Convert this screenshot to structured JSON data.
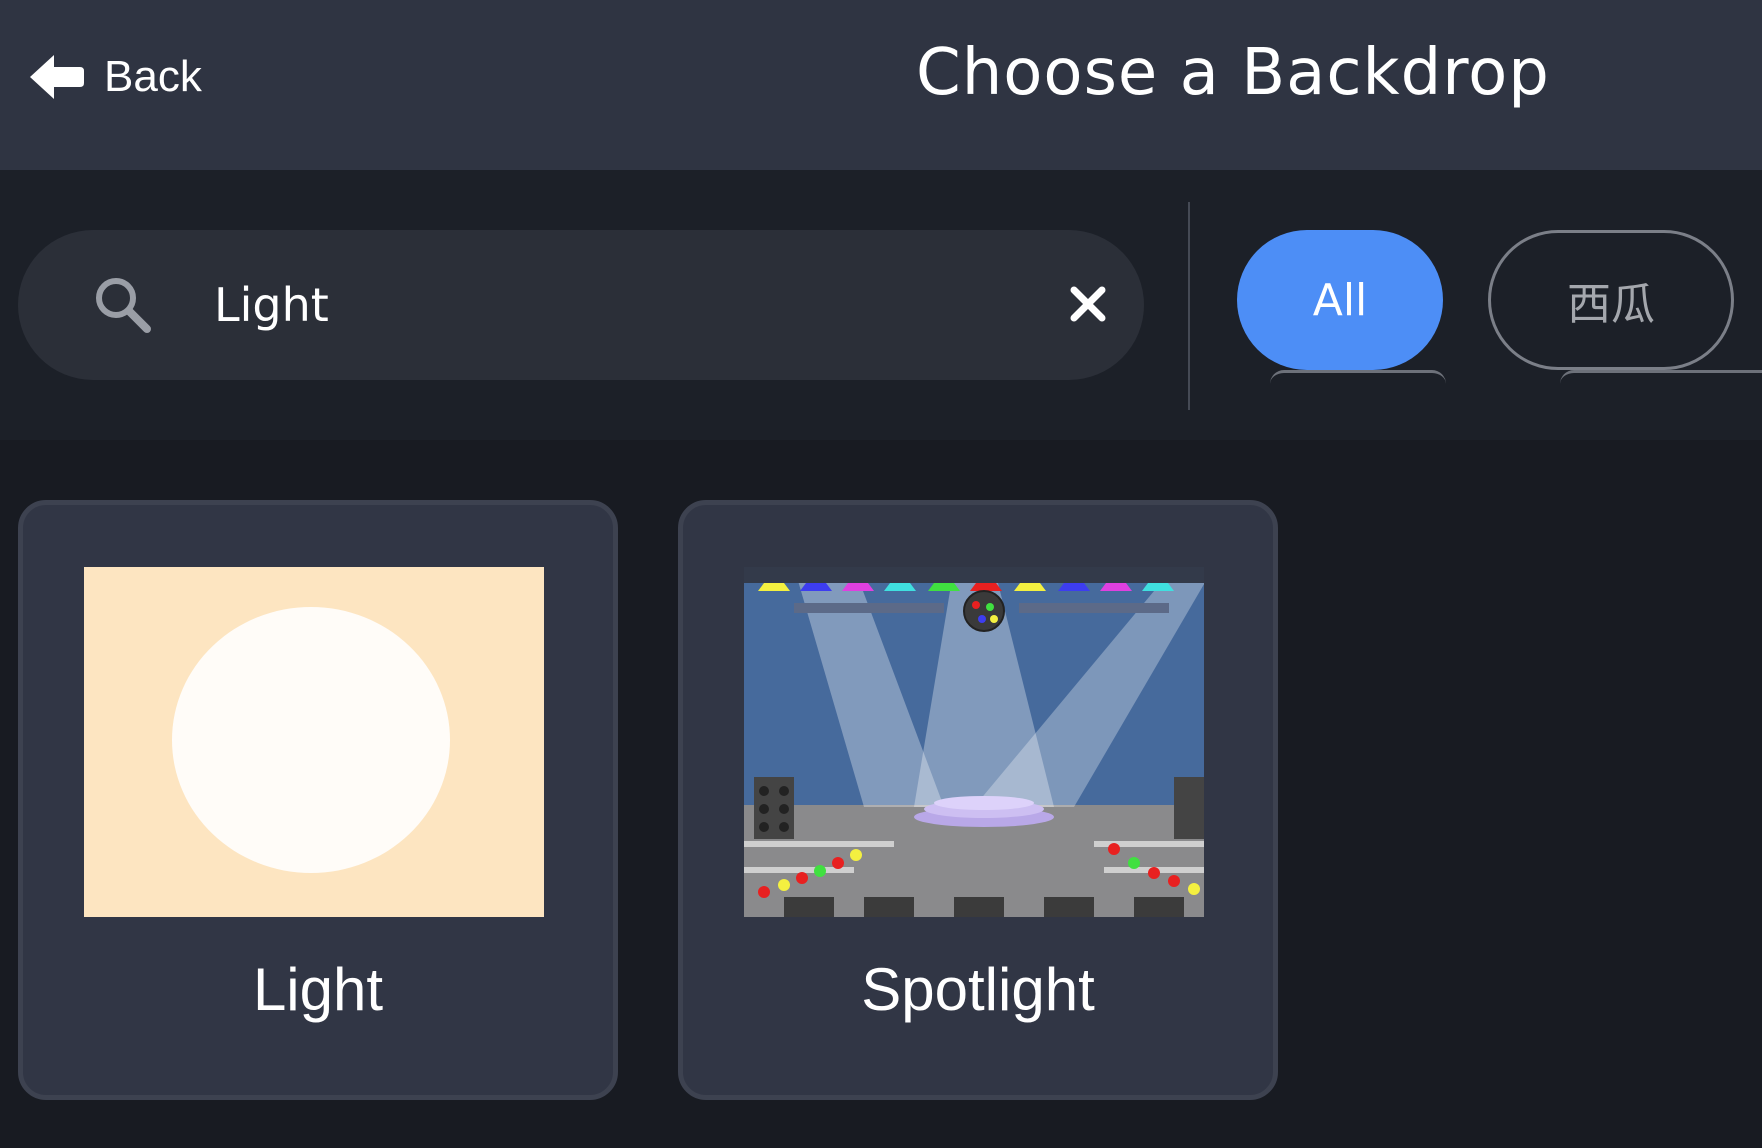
{
  "header": {
    "back_label": "Back",
    "title": "Choose a Backdrop"
  },
  "search": {
    "value": "Light",
    "placeholder": ""
  },
  "tags": [
    {
      "label": "All",
      "selected": true
    },
    {
      "label": "西瓜",
      "selected": false
    }
  ],
  "items": [
    {
      "label": "Light"
    },
    {
      "label": "Spotlight"
    }
  ],
  "colors": {
    "header_bg": "#2f3442",
    "accent": "#4d8ef6",
    "card_bg": "#313645",
    "page_bg": "#181b22"
  },
  "icons": {
    "back": "arrow-left-icon",
    "search": "magnifier-icon",
    "clear": "x-icon"
  }
}
